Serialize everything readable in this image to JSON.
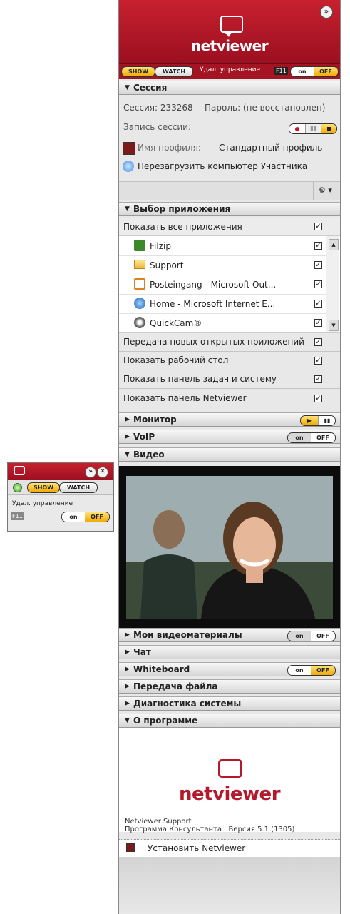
{
  "app": {
    "logo": "netviewer",
    "collapse_glyph": "»"
  },
  "topbar": {
    "show_label": "SHOW",
    "watch_label": "WATCH",
    "remote_label": "Удал. управление",
    "f11_label": "F11",
    "on_label": "on",
    "off_label": "OFF"
  },
  "session": {
    "header": "Сессия",
    "session_label": "Сессия: 233268",
    "password_label": "Пароль: (не восстановлен)",
    "recording_label": "Запись сессии:",
    "profile_label": "Имя профиля:",
    "profile_value": "Стандартный профиль",
    "restart_label": "Перезагрузить компьютер Участника",
    "gear_glyph": "⚙ ▾"
  },
  "apps": {
    "header": "Выбор приложения",
    "show_all": "Показать все приложения",
    "items": [
      {
        "label": "Filzip",
        "icon": "filzip-icon"
      },
      {
        "label": "Support",
        "icon": "folder-icon"
      },
      {
        "label": "Posteingang - Microsoft Out...",
        "icon": "outlook-icon"
      },
      {
        "label": "Home - Microsoft Internet E...",
        "icon": "ie-icon"
      },
      {
        "label": "QuickCam®",
        "icon": "webcam-icon"
      }
    ],
    "transfer_new": "Передача новых открытых приложений",
    "show_desktop": "Показать рабочий стол",
    "show_taskbar": "Показать панель задач и систему",
    "show_netviewer_panel": "Показать панель Netviewer"
  },
  "sections": {
    "monitor": "Монитор",
    "voip": "VoIP",
    "video": "Видео",
    "my_videos": "Мои видеоматериалы",
    "chat": "Чат",
    "whiteboard": "Whiteboard",
    "file_transfer": "Передача файла",
    "diagnostics": "Диагностика системы",
    "about": "О программе"
  },
  "toggle": {
    "on": "on",
    "off": "OFF"
  },
  "about": {
    "logo": "netviewer",
    "line1": "Netviewer Support",
    "line2": "Программа Консультанта   Версия 5.1 (1305)",
    "install_label": "Установить Netviewer"
  },
  "mini": {
    "show_label": "SHOW",
    "watch_label": "WATCH",
    "remote_label": "Удал. управление",
    "f11_label": "F11",
    "on_label": "on",
    "off_label": "OFF"
  },
  "colors": {
    "brand_red": "#b5182a",
    "highlight_yellow": "#f2b400",
    "panel_gray": "#e8e8e8"
  }
}
